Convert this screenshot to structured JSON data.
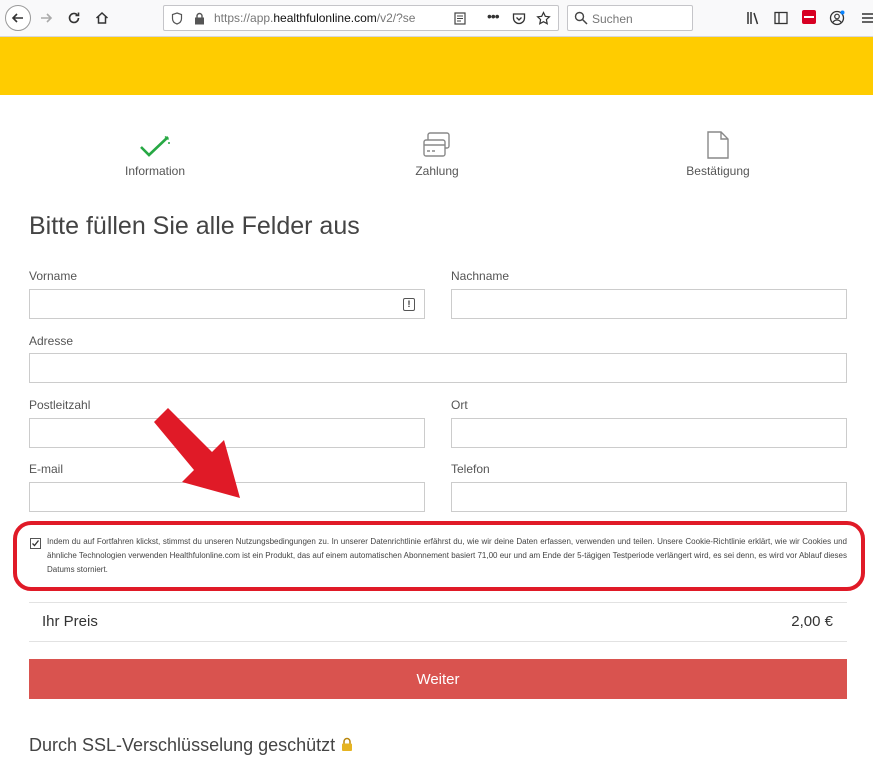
{
  "browser": {
    "url_prefix": "https://app.",
    "url_domain": "healthfulonline.com",
    "url_suffix": "/v2/?se",
    "search_placeholder": "Suchen"
  },
  "steps": [
    {
      "label": "Information"
    },
    {
      "label": "Zahlung"
    },
    {
      "label": "Bestätigung"
    }
  ],
  "form": {
    "heading": "Bitte füllen Sie alle Felder aus",
    "vorname_label": "Vorname",
    "nachname_label": "Nachname",
    "adresse_label": "Adresse",
    "plz_label": "Postleitzahl",
    "ort_label": "Ort",
    "email_label": "E-mail",
    "telefon_label": "Telefon"
  },
  "consent": {
    "checked": true,
    "text": "Indem du auf Fortfahren klickst, stimmst du unseren Nutzungsbedingungen zu. In unserer Datenrichtlinie erfährst du, wie wir deine Daten erfassen, verwenden und teilen. Unsere Cookie-Richtlinie erklärt, wie wir Cookies und ähnliche Technologien verwenden Healthfulonline.com ist ein Produkt, das auf einem automatischen Abonnement basiert 71,00 eur und am Ende der 5-tägigen Testperiode verlängert wird, es sei denn, es wird vor Ablauf dieses Datums storniert."
  },
  "price": {
    "label": "Ihr Preis",
    "value": "2,00 €"
  },
  "submit_label": "Weiter",
  "ssl_text": "Durch SSL-Verschlüsselung geschützt",
  "colors": {
    "yellow_band": "#ffcc00",
    "button": "#d9534f",
    "highlight": "#e01a27",
    "check_green": "#27a844"
  }
}
